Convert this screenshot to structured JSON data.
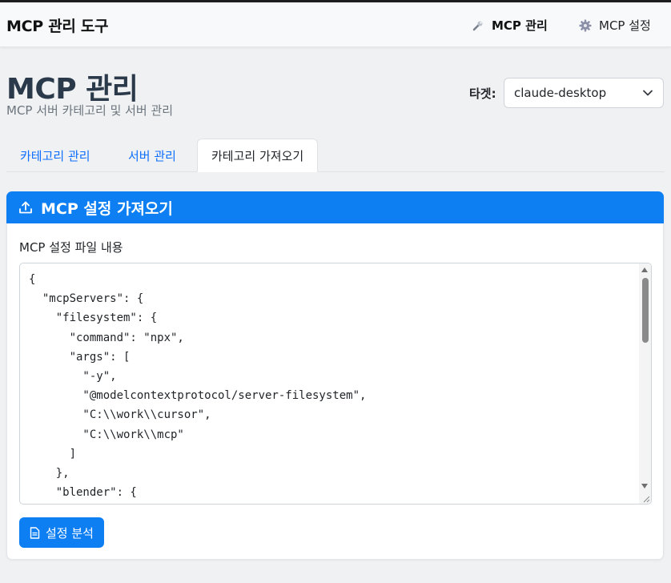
{
  "app": {
    "title": "MCP 관리 도구"
  },
  "nav": {
    "items": [
      {
        "label": "MCP 관리",
        "icon": "wrench-icon",
        "active": true
      },
      {
        "label": "MCP 설정",
        "icon": "gear-icon",
        "active": false
      }
    ]
  },
  "page": {
    "title": "MCP 관리",
    "subtitle": "MCP 서버 카테고리 및 서버 관리"
  },
  "target": {
    "label": "타겟:",
    "selected": "claude-desktop"
  },
  "tabs": [
    {
      "label": "카테고리 관리",
      "active": false
    },
    {
      "label": "서버 관리",
      "active": false
    },
    {
      "label": "카테고리 가져오기",
      "active": true
    }
  ],
  "card": {
    "header": "MCP 설정 가져오기",
    "header_icon": "upload-icon",
    "field_label": "MCP 설정 파일 내용",
    "textarea_value": "{\n  \"mcpServers\": {\n    \"filesystem\": {\n      \"command\": \"npx\",\n      \"args\": [\n        \"-y\",\n        \"@modelcontextprotocol/server-filesystem\",\n        \"C:\\\\work\\\\cursor\",\n        \"C:\\\\work\\\\mcp\"\n      ]\n    },\n    \"blender\": {",
    "analyze_button": "설정 분석",
    "analyze_icon": "file-text-icon"
  },
  "colors": {
    "primary": "#0d7ff3",
    "link": "#0d6efd",
    "title": "#2b3a4a"
  }
}
